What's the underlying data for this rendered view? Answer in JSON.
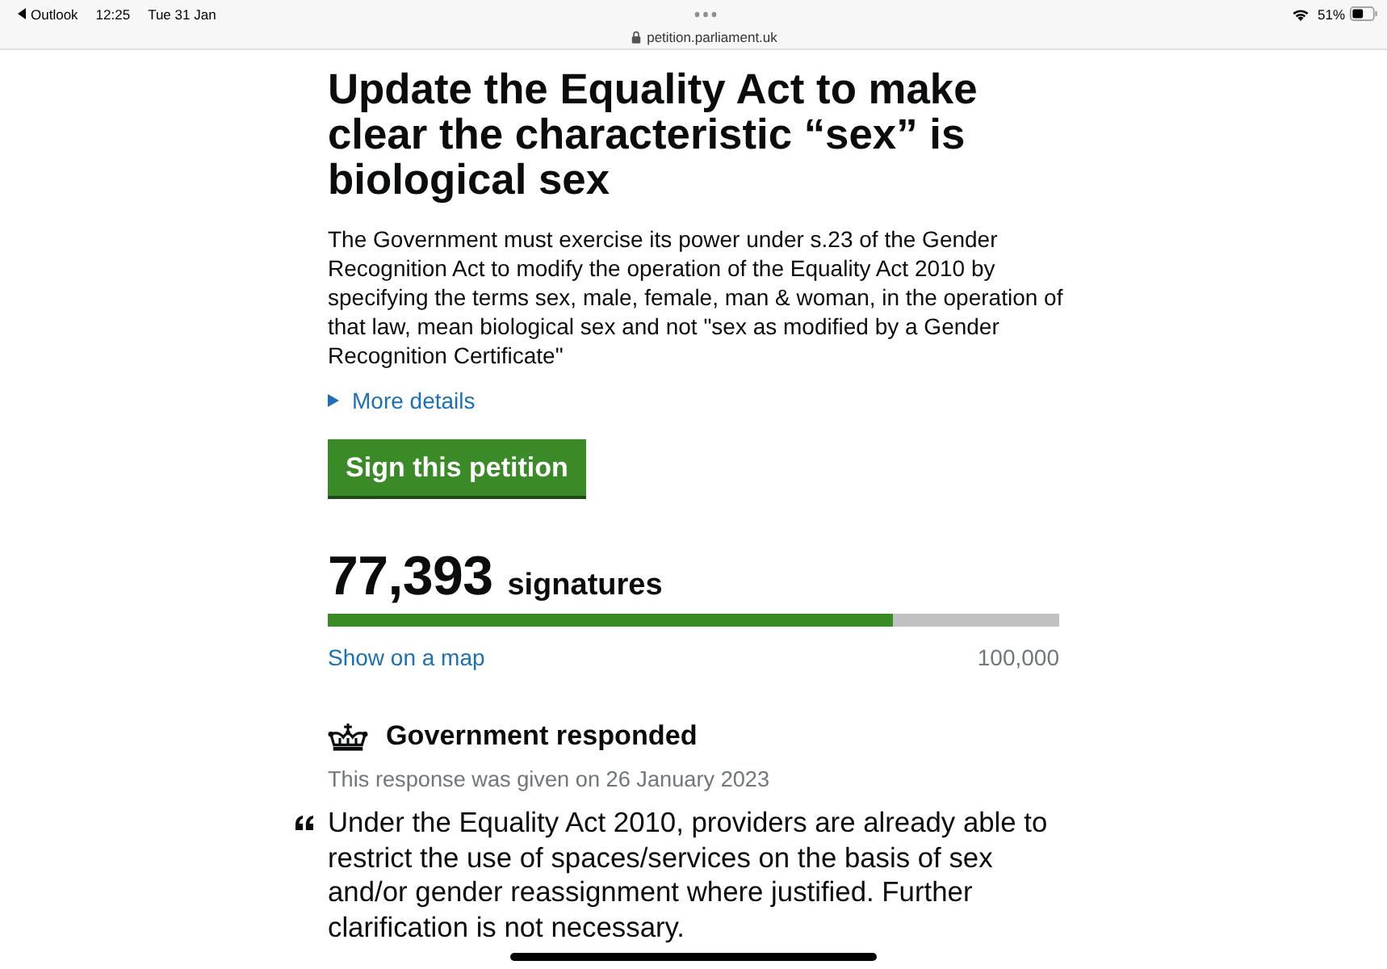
{
  "status_bar": {
    "back_app": "Outlook",
    "time": "12:25",
    "date": "Tue 31 Jan",
    "battery": "51%"
  },
  "address_bar": {
    "url": "petition.parliament.uk"
  },
  "petition": {
    "title": "Update the Equality Act to make clear the characteristic “sex” is biological sex",
    "description": "The Government must exercise its power under s.23 of the Gender Recognition Act to modify the operation of the Equality Act 2010 by specifying the terms sex, male, female, man & woman, in the operation of that law, mean biological sex and not \"sex as modified by a Gender Recognition Certificate\"",
    "more_details": {
      "label": "More details",
      "expanded": false
    },
    "sign_button": "Sign this petition"
  },
  "signatures": {
    "count": "77,393",
    "label": "signatures",
    "level": 0.773,
    "map_link": "Show on a map",
    "goal": "100,000"
  },
  "response": {
    "heading": "Government responded",
    "given_on": "This response was given on 26 January 2023",
    "quote": "Under the Equality Act 2010, providers are already able to restrict the use of spaces/services on the basis of sex and/or gender reassignment where justified. Further clarification is not necessary."
  }
}
